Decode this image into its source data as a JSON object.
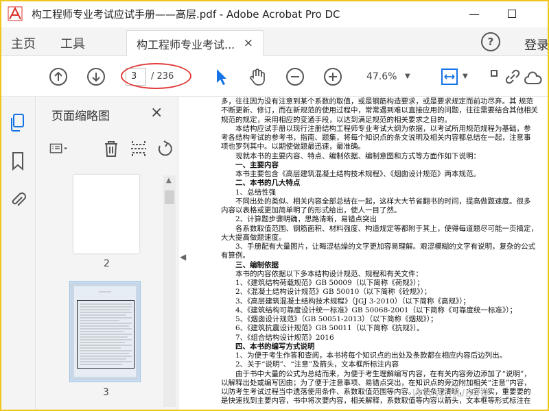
{
  "window": {
    "title": "构工程师专业考试应试手册——高层.pdf - Adobe Acrobat Pro DC",
    "minimize": "—",
    "maximize": "☐"
  },
  "menu": {
    "home": "主页",
    "tools": "工具",
    "doc_tab": "构工程师专业考试...",
    "tab_close": "×",
    "help": "?",
    "login": "登录"
  },
  "toolbar": {
    "page_current": "3",
    "page_total": "/ 236",
    "zoom": "47.6%"
  },
  "thumbnails": {
    "title": "页面缩略图",
    "close": "×",
    "pages": [
      {
        "num": "2"
      },
      {
        "num": "3"
      }
    ]
  },
  "document": {
    "lines": [
      "多，往往因为没有注意到某个系数的取值，或是钢筋构造要求，或是要求规定而前功尽弃。其 规范",
      "不断更新、修订，而在新规范的使用过程中，常常遇到难以直接应用的问题，往往需要结合其他相关",
      "规范的规定，采用相应的变通手段，以达到满足规范的相关要求之目的。",
      "　　本结构应试手册以现行注册结构工程师专业考试大纲为依据，以考试所用规范规程为基础，参",
      "考各结构考试的参考书，指南、题集，将每个知识点的条文说明及相关内容都总结在一起，注意事",
      "项也罗列其中。以期使做题最迅速，最准确。",
      "　　现就本书的主要内容、特点、编制依据、编制意图和方式等方面作如下说明：",
      "　　一、主要内容",
      "　　本书主要包含《高层建筑混凝土结构技术规程》、《烟囱设计规范》两本规范。",
      "　　二、本书的几大特点",
      "　　1、总结性强",
      "　　不同出处的类似、相关内容全部总结在一起，这样大大节省翻书的时间，提高做题速度。很多",
      "内容以表格或更加简单明了的形式给出，使人一目了然。",
      "　　2、计算题步骤明确，思路清晰，易错点突出",
      "　　各系数取值范围、钢筋面积、材料强度、构造规定等都附于其上，使得每道题尽可能一页搞定，",
      "大大提高做题速度。",
      "　　3、手册配有大量图片，让晦涩枯燥的文字更加容易理解。艰涩模糊的文字有说明，复杂的公式",
      "有算例。",
      "　　三、编制依据",
      "　　本书的内容依据以下多本结构设计规范、规程和有关文件：",
      "　　1、《建筑结构荷载规范》GB 50009（以下简称《荷规》）；",
      "　　2、《混凝土结构设计规范》GB 50010（以下简称《砼规》）；",
      "　　3、《高层建筑混凝土结构技术规程》（JGJ 3-2010）（以下简称《高规》）；",
      "　　4、《建筑结构可靠度设计统一标准》GB 50068-2001（以下简称《可靠度统一标准》）；",
      "　　5、《烟囱设计规范》（GB 50051-2013）（以下简称《烟规》）；",
      "　　6、《建筑抗震设计规范》GB 50011（以下简称《抗规》）。",
      "　　7、《组合结构设计规范》2016",
      "　　四、本书的编写方式说明",
      "　　1、为便于考生作答和查阅，本书将每个知识点的出处及条款都在相应内容后边列出。",
      "　　2、关于“说明”、“注意”及箭头，文本框所标注内容",
      "　　由于书中大量的公式为总结而来，为便于考生理解编写内容，在有关内容旁边添加了“说明”，",
      "以解释出处或编写因由；为了便于注意事项、易错点突出，在知识点的旁边附加相关“注意”内容，",
      "以防考生考试过程当中遗落使用条件、系数取值范围等内容。为使条理清晰，内容详实，重要要的",
      "是快速找到主要内容，书中将次要内容，相关解释，系数取值等内容以箭头，文本框等形式标注在"
    ],
    "watermark": "www.ilus.io"
  },
  "colors": {
    "frame": "#f0c419",
    "accent": "#1473e6",
    "annotation": "#e03a3a"
  }
}
